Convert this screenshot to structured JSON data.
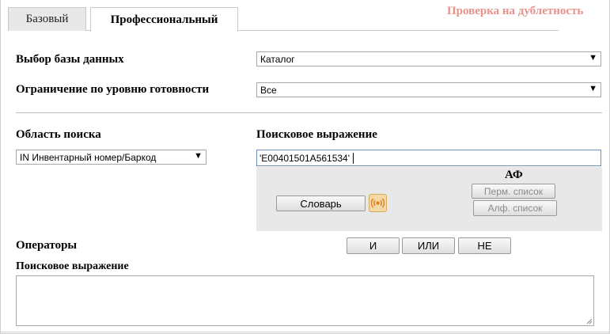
{
  "tabs": [
    {
      "label": "Базовый",
      "active": false
    },
    {
      "label": "Профессиональный",
      "active": true
    }
  ],
  "duplicate_check_link": "Проверка на дублетность",
  "database": {
    "label": "Выбор базы данных",
    "value": "Каталог"
  },
  "readiness": {
    "label": "Ограничение по уровню готовности",
    "value": "Все"
  },
  "search_area": {
    "label": "Область поиска",
    "value": "IN Инвентарный номер/Баркод"
  },
  "search_expression": {
    "label": "Поисковое выражение",
    "value": "'E00401501A561534'"
  },
  "panel": {
    "af_label": "АФ",
    "dictionary_button": "Словарь",
    "perm_list_button": "Перм. список",
    "alph_list_button": "Алф. список",
    "voice_icon": "broadcast-icon"
  },
  "operators": {
    "label": "Операторы",
    "and": "И",
    "or": "ИЛИ",
    "not": "НЕ"
  },
  "result_expression": {
    "label": "Поисковое выражение",
    "value": ""
  },
  "colors": {
    "accent_link": "#e8928a",
    "panel_bg": "#e8e8e8",
    "voice_bg": "#f5d9a4"
  }
}
